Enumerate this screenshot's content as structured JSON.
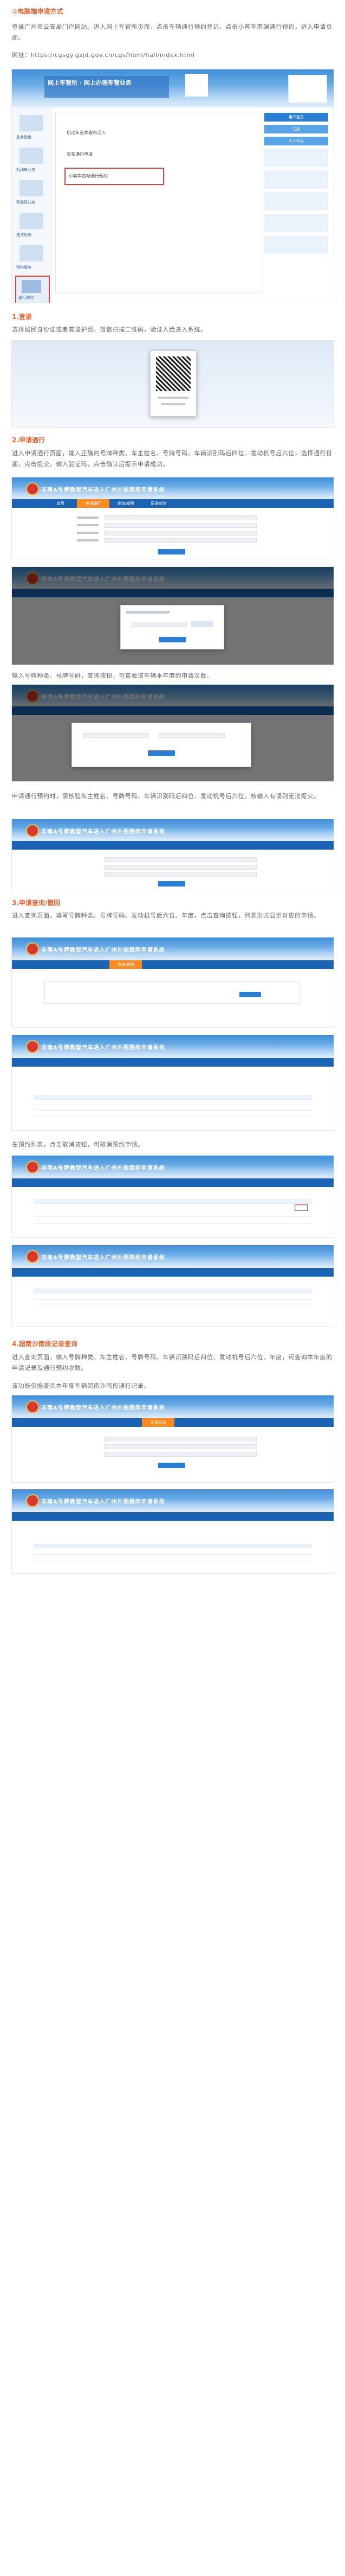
{
  "header": {
    "title": "◎电脑端申请方式",
    "intro": "登录广州市公安局门户网站，进入网上车管所页面，点击车辆通行预约登记，点击小客车南端通行预约，进入申请页面。",
    "url": "网址：https://cgsgy.gzjd.gov.cn/cgs/html/hall/index.html"
  },
  "portal": {
    "banner_title": "网上车管所 · 网上办理车管业务",
    "side_items": [
      "业务指南",
      "机动车业务",
      "驾驶证业务",
      "违法处理",
      "预约服务",
      "通行预约"
    ],
    "menu_items": [
      "机动车在本省内迁入",
      "货车通行申请",
      "小客车南端通行预约"
    ],
    "right_buttons": [
      "用户登录",
      "注册",
      "个人中心"
    ]
  },
  "sections": {
    "login": {
      "heading": "1.登录",
      "body": "选择居民身份证或者普通护照，微信扫描二维码，验证人脸进入系统。"
    },
    "apply": {
      "heading": "2.申请通行",
      "body1": "进入申请通行页面，输入正确的号牌种类、车主姓名、号牌号码、车辆识别码后四位、发动机号后六位，选择通行日期，点击提交，输入验证码，点击确认后提示申请成功。",
      "body2": "输入号牌种类、号牌号码，查询按钮，可查看该车辆本年度的申请次数。",
      "body3": "申请通行预约时，需核验车主姓名、号牌号码、车辆识别码后四位、发动机号后六位，核输入有误则无法提交。"
    },
    "query": {
      "heading": "3.申请查询/撤回",
      "body1": "进入查询页面，填写号牌种类、号牌号码、发动机号后六位、年度，点击查询按钮，列表形式显示对应的申请。",
      "body2": "在预约列表，点击取消按钮，可取消预约申请。"
    },
    "record": {
      "heading": "4.超南沙南段记录查询",
      "body1": "进入查询页面，输入号牌种类、车主姓名、号牌号码、车辆识别码后四位、发动机号后六位、年度，可查询本年度的申请记录及通行预约次数。",
      "body2": "该功能仅能查询本年度车辆超南沙南段通行记录。"
    }
  },
  "system": {
    "banner_title": "非南A号牌微型汽车进入广州外围路网申请系统",
    "tabs": [
      "首页",
      "申请通行",
      "查询/撤回",
      "记录查询"
    ]
  },
  "colors": {
    "accent": "#e8652f",
    "banner": "#3f8fd8",
    "nav": "#1b63b5",
    "active_tab": "#ff8a1f"
  },
  "icons": [
    "emblem-icon",
    "qr-code-icon",
    "city-skyline-icon"
  ]
}
